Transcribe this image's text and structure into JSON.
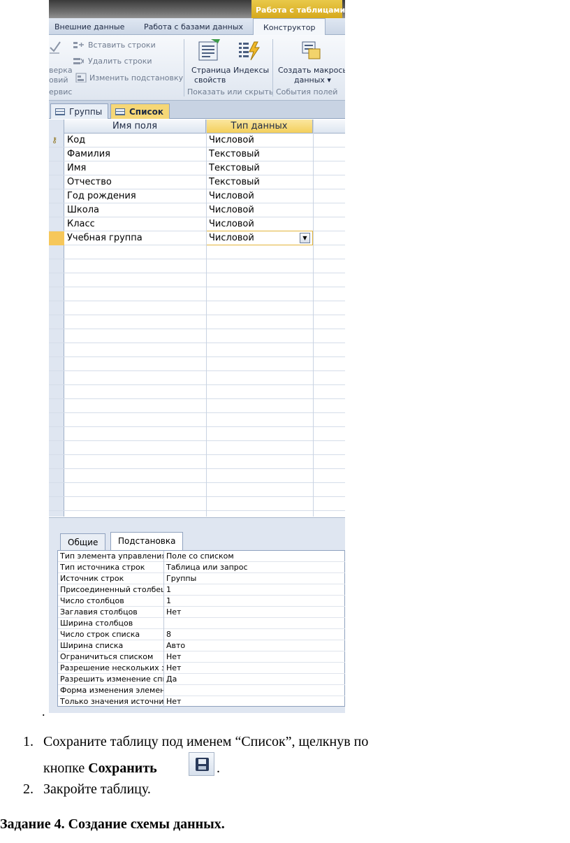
{
  "ribbon": {
    "context_tab": "Работа с таблицами",
    "tabs": [
      "Внешние данные",
      "Работа с базами данных",
      "Конструктор"
    ],
    "active_tab": "Конструктор",
    "tools": {
      "partial_left": [
        "верка",
        "овий"
      ],
      "insert_rows": "Вставить строки",
      "delete_rows": "Удалить строки",
      "change_lookup": "Изменить подстановку",
      "group_service": "ервис",
      "property_sheet": [
        "Страница",
        "свойств"
      ],
      "indexes": "Индексы",
      "group_show_hide": "Показать или скрыть",
      "create_macro": [
        "Создать макрось",
        "данных ▾"
      ],
      "group_events": "События полей"
    }
  },
  "doc_tabs": [
    "Группы",
    "Список"
  ],
  "grid": {
    "headers": [
      "Имя поля",
      "Тип данных"
    ],
    "rows": [
      {
        "name": "Код",
        "type": "Числовой"
      },
      {
        "name": "Фамилия",
        "type": "Текстовый"
      },
      {
        "name": "Имя",
        "type": "Текстовый"
      },
      {
        "name": "Отчество",
        "type": "Текстовый"
      },
      {
        "name": "Год рождения",
        "type": "Числовой"
      },
      {
        "name": "Школа",
        "type": "Числовой"
      },
      {
        "name": "Класс",
        "type": "Числовой"
      },
      {
        "name": "Учебная группа",
        "type": "Числовой"
      }
    ]
  },
  "properties": {
    "tabs": [
      "Общие",
      "Подстановка"
    ],
    "rows": [
      {
        "name": "Тип элемента управления",
        "value": "Поле со списком"
      },
      {
        "name": "Тип источника строк",
        "value": "Таблица или запрос"
      },
      {
        "name": "Источник строк",
        "value": "Группы"
      },
      {
        "name": "Присоединенный столбец",
        "value": "1"
      },
      {
        "name": "Число столбцов",
        "value": "1"
      },
      {
        "name": "Заглавия столбцов",
        "value": "Нет"
      },
      {
        "name": "Ширина столбцов",
        "value": ""
      },
      {
        "name": "Число строк списка",
        "value": "8"
      },
      {
        "name": "Ширина списка",
        "value": "Авто"
      },
      {
        "name": "Ограничиться списком",
        "value": "Нет"
      },
      {
        "name": "Разрешение нескольких значений",
        "value": "Нет"
      },
      {
        "name": "Разрешить изменение списка",
        "value": "Да"
      },
      {
        "name": "Форма изменения элементов списка",
        "value": ""
      },
      {
        "name": "Только значения источника строк",
        "value": "Нет"
      }
    ]
  },
  "document": {
    "stray_dot": ".",
    "item1_num": "1.",
    "item1_line1": "Сохраните таблицу под именем “Список”, щелкнув по",
    "item1_line2_pre": "кнопке ",
    "item1_bold": "Сохранить",
    "item1_after": ".",
    "item2_num": "2.",
    "item2_text": "Закройте таблицу.",
    "heading": "Задание 4. Создание схемы данных."
  }
}
